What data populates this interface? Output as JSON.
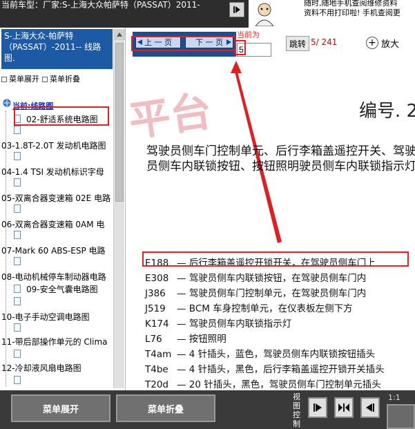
{
  "header": {
    "car_title": "当前车型：厂家:S-上海大众帕萨特（PASSAT）2011-",
    "ad_line1": "随时,随地手机查阅维修资料",
    "ad_line2": "资料不用打印啦! 手机查阅更"
  },
  "sidebar": {
    "model_label": "S-上海大众-帕萨特（PASSAT）-2011-- 线路图.",
    "menu_expand": "菜单展开",
    "menu_collapse": "菜单折叠",
    "current_label": "当前:线路图",
    "items": [
      {
        "label": "02-舒适系统电路图"
      },
      {
        "label": "03-1.8T-2.0T 发动机电路图"
      },
      {
        "label": "04-1.4 TSI 发动机标识字母"
      },
      {
        "label": "05-双离合器变速箱 02E 电路"
      },
      {
        "label": "06-双离合器变速箱 0AM 电"
      },
      {
        "label": "07-Mark 60 ABS-ESP 电路"
      },
      {
        "label": "08-电动机械停车制动器电路"
      },
      {
        "label": "09-安全气囊电路图"
      },
      {
        "label": "10-电子手动空调电路图"
      },
      {
        "label": "11-带后部操作单元的 Clima"
      },
      {
        "label": "12-冷却液风扇电路图"
      }
    ]
  },
  "viewer": {
    "prev_label": "上 一 页",
    "next_label": "下 一 页",
    "current_page_label": "当前为",
    "page_input_value": "5",
    "jump_label": "跳转",
    "page_count": "5/ 241",
    "zoom_in_label": "放大",
    "watermark": "平台",
    "diagram_number": "编号. 2",
    "diagram_title": "驾驶员侧车门控制单元、后行李箱盖遥控开关、驾驶员侧车内联锁按钮、按钮照明驶员侧车内联锁指示灯",
    "legend": [
      {
        "code": "E188",
        "desc": "— 后行李箱盖遥控开锁开关，在驾驶员侧车门上"
      },
      {
        "code": "E308",
        "desc": "— 驾驶员侧车内联锁按钮，在驾驶员侧车门内"
      },
      {
        "code": "J386",
        "desc": "— 驾驶员侧车门控制单元，在驾驶员侧车门内"
      },
      {
        "code": "J519",
        "desc": "— BCM 车身控制单元，在仪表板左侧下方"
      },
      {
        "code": "K174",
        "desc": "— 驾驶员侧车内联锁指示灯"
      },
      {
        "code": "L76",
        "desc": "— 按钮照明"
      },
      {
        "code": "T4am",
        "desc": "— 4 针插头，蓝色，驾驶员侧车内联锁按钮插头"
      },
      {
        "code": "T4be",
        "desc": "— 4 针插头，黑色，后行李箱盖遥控开锁开关插头"
      },
      {
        "code": "T20d",
        "desc": "— 20 针插头，黑色，驾驶员侧车门控制单元插头"
      }
    ]
  },
  "bottom": {
    "menu_expand": "菜单展开",
    "menu_collapse": "菜单折叠",
    "view_control_label": "视图控制",
    "zoom_level": "1:1"
  },
  "colors": {
    "header_bg": "#2d2d2d",
    "model_box": "#1c5aa6",
    "pager_bg": "#1d4f8f",
    "highlight_red": "#e02020",
    "bottom_bg": "#3a3a3a"
  }
}
